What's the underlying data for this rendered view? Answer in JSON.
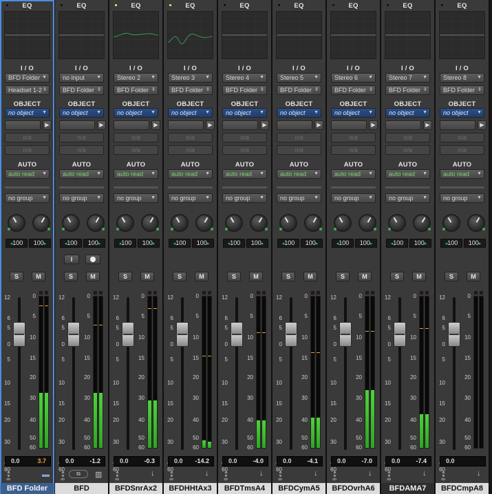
{
  "section_labels": {
    "eq": "EQ",
    "io": "I / O",
    "object": "OBJECT",
    "auto": "AUTO",
    "na": "n/a"
  },
  "button_labels": {
    "solo": "S",
    "mute": "M",
    "input": "I"
  },
  "fader_scale": [
    "12",
    "6",
    "5",
    "0",
    "5",
    "10",
    "15",
    "20",
    "30",
    "40",
    "60",
    "∞"
  ],
  "meter_scale": [
    "0",
    "5",
    "10",
    "15",
    "20",
    "30",
    "40",
    "50",
    "60"
  ],
  "colors": {
    "selected_strip": "#4a90e2",
    "meter_green": "#2fa524",
    "peak_amber": "#e8a33a",
    "auto_read": "#7ed36f",
    "object_blue": "#1f3e70"
  },
  "icons": {
    "play": "▶",
    "record": "record-icon",
    "folder": "folder-icon",
    "down_arrow": "↓",
    "updown": "updown-arrows-icon",
    "pan_left": "◂",
    "pan_right": "▸",
    "midi": "midi-keyboard-icon",
    "window": "window-icon"
  },
  "tracks": [
    {
      "name": "BFD Folder",
      "selected": true,
      "eq_active": false,
      "input": "BFD Folder",
      "output": "Headset 1-2",
      "object": "no object",
      "automation": "auto read",
      "group": "no group",
      "pan_left": "100",
      "pan_right": "100",
      "has_input_controls": false,
      "volume": "0.0",
      "peak": "3.7",
      "peak_hot": true,
      "meter_level": 0.36,
      "peak_mark": 0.93,
      "bottom_icon": "folder"
    },
    {
      "name": "BFD",
      "selected": false,
      "eq_active": false,
      "input": "no input",
      "output": "BFD Folder",
      "object": "no object",
      "automation": "auto read",
      "group": "no group",
      "pan_left": "100",
      "pan_right": "100",
      "has_input_controls": true,
      "volume": "0.0",
      "peak": "-1.2",
      "peak_hot": false,
      "meter_level": 0.36,
      "peak_mark": 0.8,
      "bottom_icon": "midi"
    },
    {
      "name": "BFDSnrAx2",
      "selected": false,
      "eq_active": true,
      "input": "Stereo 2",
      "output": "BFD Folder",
      "object": "no object",
      "automation": "auto read",
      "group": "no group",
      "pan_left": "100",
      "pan_right": "100",
      "has_input_controls": false,
      "volume": "0.0",
      "peak": "-0.3",
      "peak_hot": false,
      "meter_level": 0.31,
      "peak_mark": 0.91,
      "bottom_icon": "down_arrow"
    },
    {
      "name": "BFDHHtAx3",
      "selected": false,
      "eq_active": true,
      "input": "Stereo 3",
      "output": "BFD Folder",
      "object": "no object",
      "automation": "auto read",
      "group": "no group",
      "pan_left": "100",
      "pan_right": "100",
      "has_input_controls": false,
      "volume": "0.0",
      "peak": "-14.2",
      "peak_hot": false,
      "meter_level": 0.05,
      "peak_mark": 0.6,
      "bottom_icon": "down_arrow"
    },
    {
      "name": "BFDTmsA4",
      "selected": false,
      "eq_active": false,
      "input": "Stereo 4",
      "output": "BFD Folder",
      "object": "no object",
      "automation": "auto read",
      "group": "no group",
      "pan_left": "100",
      "pan_right": "100",
      "has_input_controls": false,
      "volume": "0.0",
      "peak": "-4.0",
      "peak_hot": false,
      "meter_level": 0.18,
      "peak_mark": 0.75,
      "bottom_icon": "down_arrow"
    },
    {
      "name": "BFDCymA5",
      "selected": false,
      "eq_active": false,
      "input": "Stereo 5",
      "output": "BFD Folder",
      "object": "no object",
      "automation": "auto read",
      "group": "no group",
      "pan_left": "100",
      "pan_right": "100",
      "has_input_controls": false,
      "volume": "0.0",
      "peak": "-4.1",
      "peak_hot": false,
      "meter_level": 0.2,
      "peak_mark": 0.62,
      "bottom_icon": "down_arrow"
    },
    {
      "name": "BFDOvrhA6",
      "selected": false,
      "eq_active": false,
      "input": "Stereo 6",
      "output": "BFD Folder",
      "object": "no object",
      "automation": "auto read",
      "group": "no group",
      "pan_left": "100",
      "pan_right": "100",
      "has_input_controls": false,
      "volume": "0.0",
      "peak": "-7.0",
      "peak_hot": false,
      "meter_level": 0.38,
      "peak_mark": 0.76,
      "bottom_icon": "down_arrow"
    },
    {
      "name": "BFDAMA7",
      "selected": false,
      "eq_active": false,
      "input": "Stereo 7",
      "output": "BFD Folder",
      "object": "no object",
      "automation": "auto read",
      "group": "no group",
      "pan_left": "100",
      "pan_right": "100",
      "has_input_controls": false,
      "volume": "0.0",
      "peak": "-7.4",
      "peak_hot": false,
      "meter_level": 0.22,
      "peak_mark": 0.78,
      "bottom_icon": "down_arrow"
    },
    {
      "name": "BFDCmpA8",
      "selected": false,
      "eq_active": false,
      "input": "Stereo 8",
      "output": "BFD Folder",
      "object": "no object",
      "automation": "auto read",
      "group": "no group",
      "pan_left": "100",
      "pan_right": "100",
      "has_input_controls": false,
      "volume": "0.0",
      "peak": "",
      "peak_hot": false,
      "meter_level": 0.0,
      "peak_mark": 0.0,
      "bottom_icon": "down_arrow"
    }
  ]
}
